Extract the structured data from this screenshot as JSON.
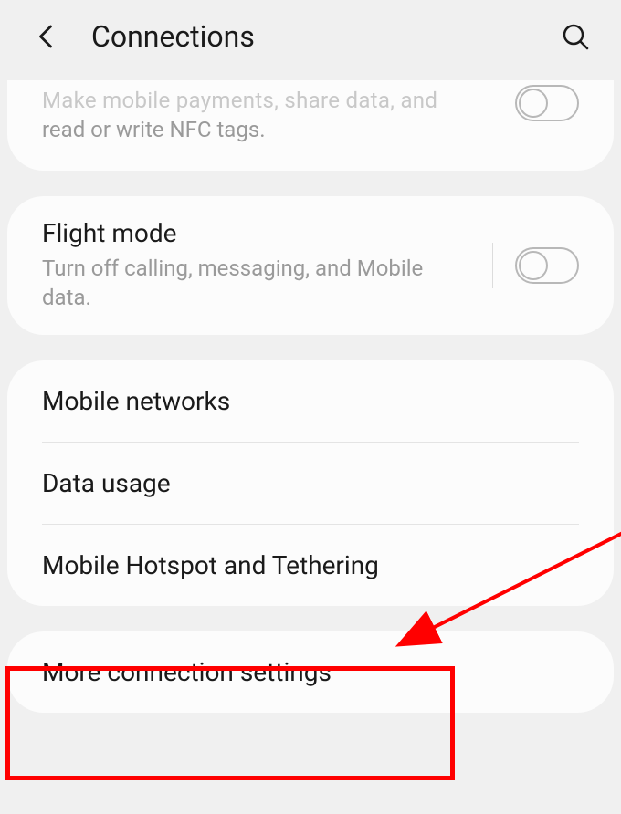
{
  "header": {
    "title": "Connections"
  },
  "nfc": {
    "partial_text_line1": "Make mobile payments, share data, and",
    "partial_text_line2": "read or write NFC tags."
  },
  "flight_mode": {
    "title": "Flight mode",
    "subtitle": "Turn off calling, messaging, and Mobile data."
  },
  "list": {
    "mobile_networks": "Mobile networks",
    "data_usage": "Data usage",
    "hotspot": "Mobile Hotspot and Tethering"
  },
  "more": {
    "label": "More connection settings"
  }
}
